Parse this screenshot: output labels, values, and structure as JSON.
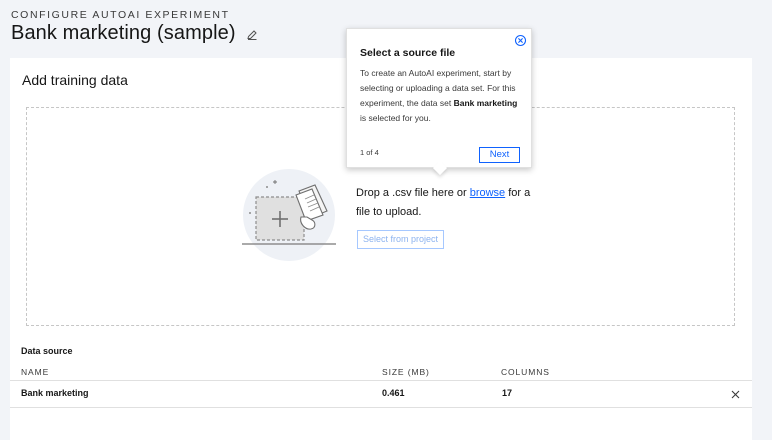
{
  "header": {
    "eyebrow": "CONFIGURE AUTOAI EXPERIMENT",
    "title": "Bank marketing (sample)",
    "edit_icon": "pencil-icon"
  },
  "panel": {
    "title": "Add training data",
    "dropzone": {
      "text_before": "Drop a .csv file here or",
      "link": "browse",
      "text_after": "for a file to upload.",
      "button": "Select from project",
      "illustration_icon": "upload-illustration-icon"
    }
  },
  "data_source": {
    "heading": "Data source",
    "columns": [
      "NAME",
      "SIZE (MB)",
      "COLUMNS"
    ],
    "rows": [
      {
        "name": "Bank marketing",
        "size": "0.461",
        "columns": "17"
      }
    ],
    "remove_icon": "close-icon"
  },
  "tooltip": {
    "title": "Select a source file",
    "body_before": "To create an AutoAI experiment, start by selecting or uploading a data set. For this experiment, the data set",
    "body_bold": "Bank marketing",
    "body_after": "is selected for you.",
    "step": "1 of 4",
    "next": "Next",
    "close_icon": "close-circle-icon"
  },
  "colors": {
    "accent": "#0f62fe",
    "background": "#f2f4f8",
    "panel": "#ffffff"
  }
}
